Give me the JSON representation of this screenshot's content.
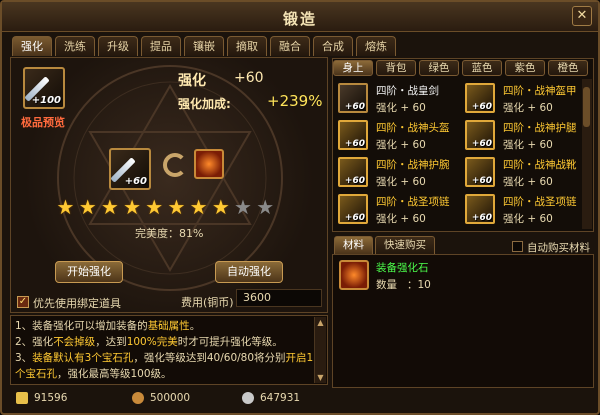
{
  "window": {
    "title": "锻造",
    "close_symbol": "✕"
  },
  "tabs": [
    "强化",
    "洗练",
    "升级",
    "提品",
    "镶嵌",
    "摘取",
    "融合",
    "合成",
    "熔炼"
  ],
  "active_tab": "强化",
  "left": {
    "preview_slot_tag": "+100",
    "preview_label": "极品预览",
    "strength_label": "强化",
    "strength_value": "+60",
    "bonus_label": "强化加成:",
    "bonus_value": "+239%",
    "current_slot_tag": "+60",
    "stars_total": 10,
    "stars_filled": 8,
    "perfection": "完美度：81%",
    "start_button": "开始强化",
    "auto_button": "自动强化",
    "bind_checkbox_label": "优先使用绑定道具",
    "bind_checked": true,
    "fee_label": "费用(铜币)",
    "fee_value": "3600"
  },
  "notes": {
    "line1_a": "1、装备强化可以增加装备的",
    "line1_b": "基础属性",
    "line1_c": "。",
    "line2_a": "2、强化",
    "line2_b": "不会掉级",
    "line2_c": "，达到",
    "line2_d": "100%完美",
    "line2_e": "时才可提升强化等级。",
    "line3_a": "3、",
    "line3_b": "装备默认有3个宝石孔",
    "line3_c": "，强化等级达到40/60/80将分别",
    "line3_d": "开启1",
    "line4_a": "个宝石孔",
    "line4_b": "，强化最高等级100级。"
  },
  "currency": [
    {
      "icon": "gold-ingot-icon",
      "value": "91596"
    },
    {
      "icon": "copper-coin-icon",
      "value": "500000"
    },
    {
      "icon": "silver-coin-icon",
      "value": "647931"
    }
  ],
  "right": {
    "tabs": [
      "身上",
      "背包",
      "绿色",
      "蓝色",
      "紫色",
      "橙色"
    ],
    "active_tab": "身上",
    "items": [
      {
        "name": "四阶・战皇剑",
        "stat": "强化 + 60",
        "rarity": "white"
      },
      {
        "name": "四阶・战神盔甲",
        "stat": "强化 + 60",
        "rarity": "gold"
      },
      {
        "name": "四阶・战神头盔",
        "stat": "强化 + 60",
        "rarity": "gold"
      },
      {
        "name": "四阶・战神护腿",
        "stat": "强化 + 60",
        "rarity": "gold"
      },
      {
        "name": "四阶・战神护腕",
        "stat": "强化 + 60",
        "rarity": "gold"
      },
      {
        "name": "四阶・战神战靴",
        "stat": "强化 + 60",
        "rarity": "gold"
      },
      {
        "name": "四阶・战圣项链",
        "stat": "强化 + 60",
        "rarity": "gold"
      },
      {
        "name": "四阶・战圣项链",
        "stat": "强化 + 60",
        "rarity": "gold"
      }
    ],
    "item_tag": "+60"
  },
  "materials": {
    "tabs": [
      "材料",
      "快速购买"
    ],
    "active_tab": "材料",
    "autobuy_label": "自动购买材料",
    "item_name": "装备强化石",
    "qty_label": "数量",
    "qty_value": "：10"
  },
  "colors": {
    "accent_gold": "#ffc933",
    "item_name_gold": "#ffc933",
    "item_name_white": "#f2f2f2",
    "material_green": "#4cff4c"
  }
}
